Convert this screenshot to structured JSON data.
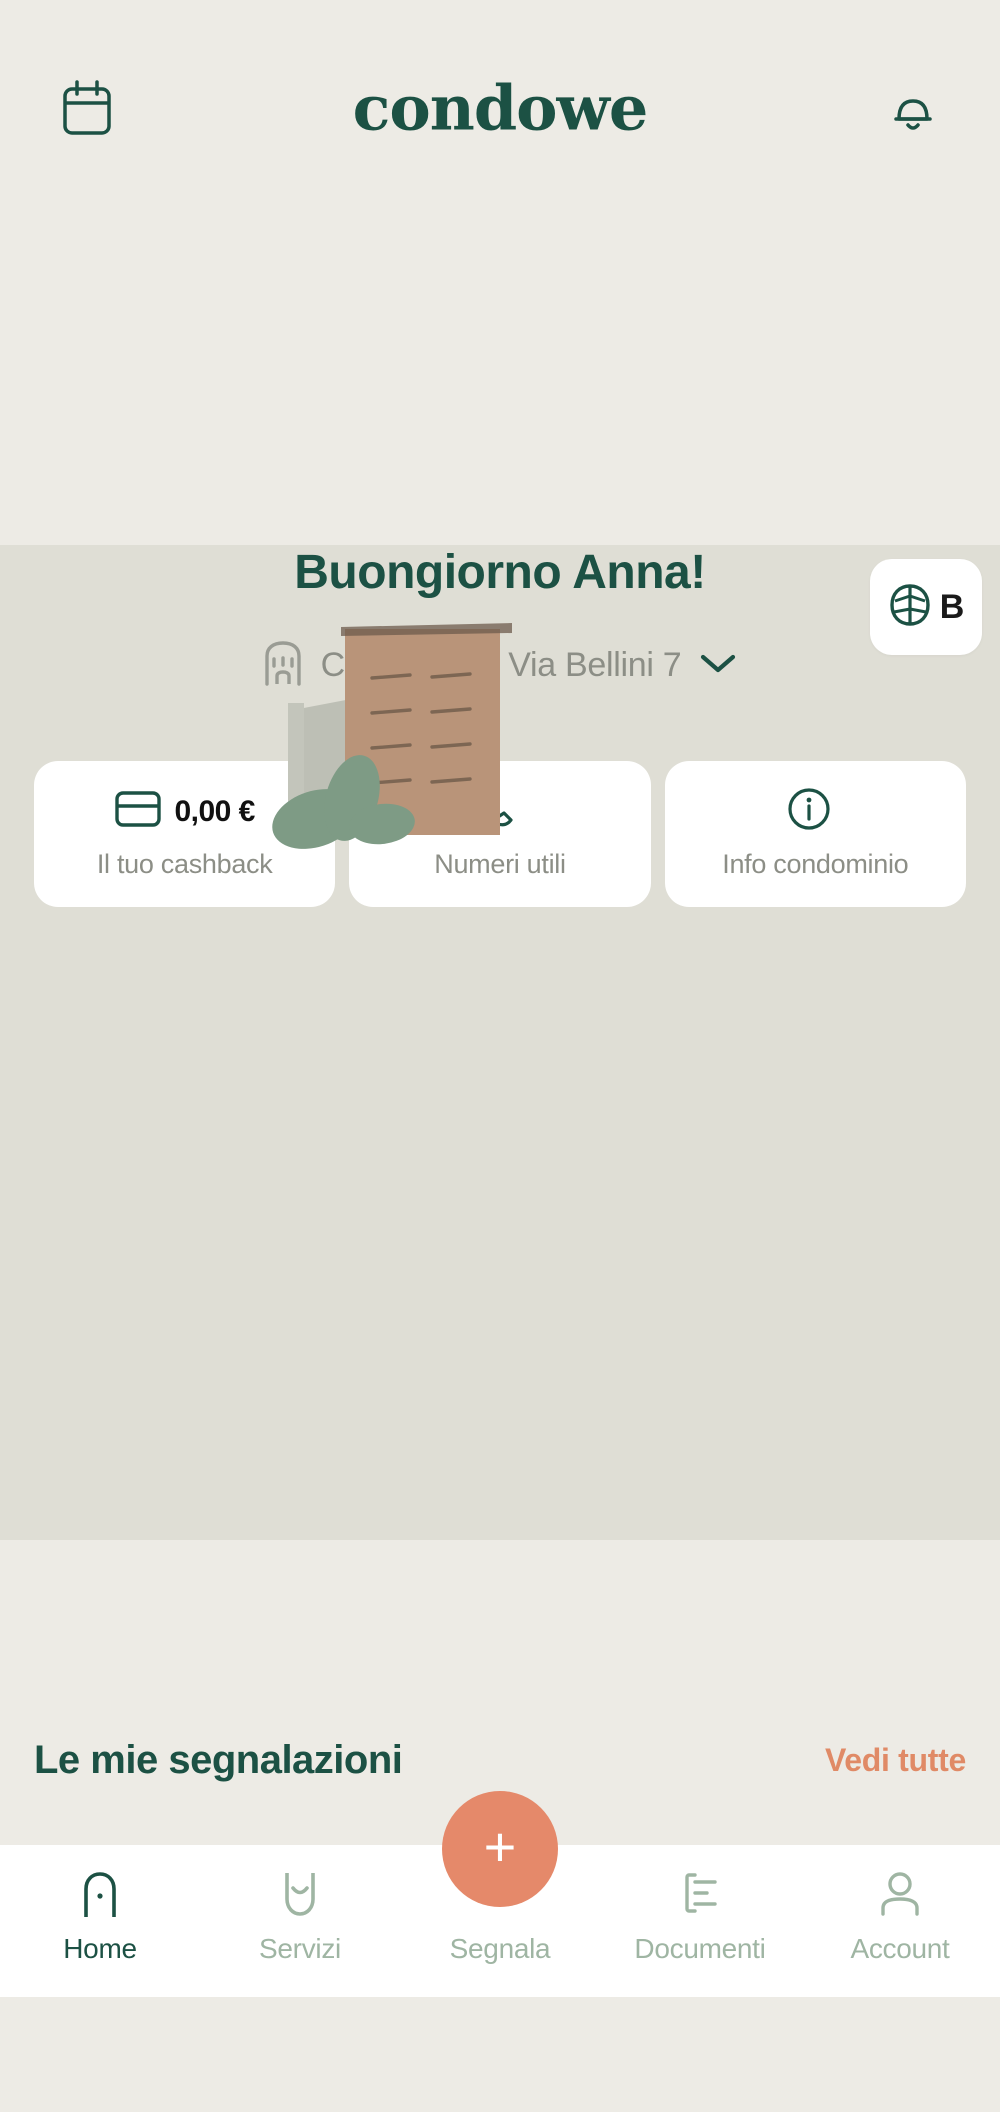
{
  "app": {
    "brand": "condowe",
    "accent_coral": "#E5896A",
    "brand_green": "#1C5144",
    "muted_green": "#9FB5A3",
    "bg_cream": "#EDEBE5",
    "bg_hero": "#DFDED5"
  },
  "header": {
    "calendar_icon": "calendar-icon",
    "title": "condowe",
    "bell_icon": "bell-icon"
  },
  "hero": {
    "badge": {
      "icon": "leaf-icon",
      "letter": "B"
    },
    "illustration": "condominium-building-illustration",
    "greeting": "Buongiorno Anna!",
    "condominium": {
      "icon": "building-icon",
      "name": "Condominio Via Bellini 7",
      "chevron": "chevron-down-icon"
    },
    "cards": [
      {
        "icon": "credit-card-icon",
        "value": "0,00 €",
        "label": "Il tuo cashback"
      },
      {
        "icon": "phone-icon",
        "value": "",
        "label": "Numeri utili"
      },
      {
        "icon": "info-icon",
        "value": "",
        "label": "Info condominio"
      }
    ]
  },
  "reports_section": {
    "title": "Le mie segnalazioni",
    "see_all": "Vedi tutte"
  },
  "fab": {
    "icon": "plus-icon",
    "label": "+"
  },
  "bottom_nav": {
    "items": [
      {
        "label": "Home",
        "icon": "home-arch-icon",
        "active": true
      },
      {
        "label": "Servizi",
        "icon": "services-icon",
        "active": false
      },
      {
        "label": "Segnala",
        "icon": "report-icon",
        "active": false
      },
      {
        "label": "Documenti",
        "icon": "documents-icon",
        "active": false
      },
      {
        "label": "Account",
        "icon": "account-person-icon",
        "active": false
      }
    ]
  }
}
